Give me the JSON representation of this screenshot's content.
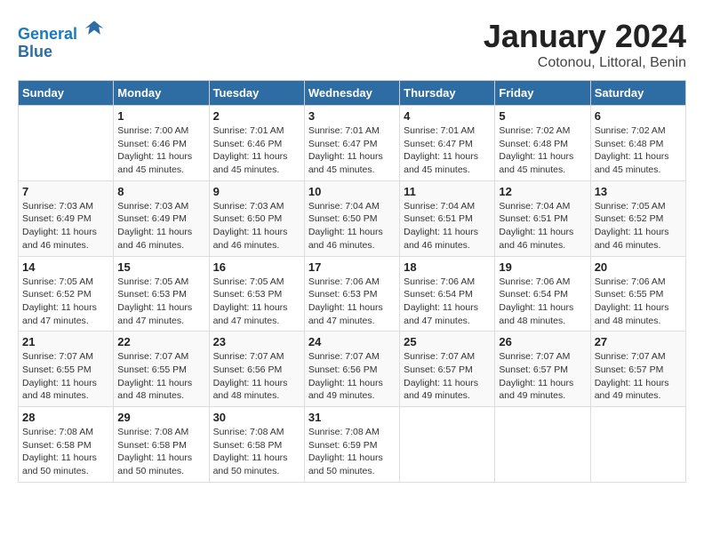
{
  "logo": {
    "line1": "General",
    "line2": "Blue"
  },
  "title": "January 2024",
  "subtitle": "Cotonou, Littoral, Benin",
  "days_of_week": [
    "Sunday",
    "Monday",
    "Tuesday",
    "Wednesday",
    "Thursday",
    "Friday",
    "Saturday"
  ],
  "weeks": [
    [
      {
        "day": "",
        "info": ""
      },
      {
        "day": "1",
        "info": "Sunrise: 7:00 AM\nSunset: 6:46 PM\nDaylight: 11 hours\nand 45 minutes."
      },
      {
        "day": "2",
        "info": "Sunrise: 7:01 AM\nSunset: 6:46 PM\nDaylight: 11 hours\nand 45 minutes."
      },
      {
        "day": "3",
        "info": "Sunrise: 7:01 AM\nSunset: 6:47 PM\nDaylight: 11 hours\nand 45 minutes."
      },
      {
        "day": "4",
        "info": "Sunrise: 7:01 AM\nSunset: 6:47 PM\nDaylight: 11 hours\nand 45 minutes."
      },
      {
        "day": "5",
        "info": "Sunrise: 7:02 AM\nSunset: 6:48 PM\nDaylight: 11 hours\nand 45 minutes."
      },
      {
        "day": "6",
        "info": "Sunrise: 7:02 AM\nSunset: 6:48 PM\nDaylight: 11 hours\nand 45 minutes."
      }
    ],
    [
      {
        "day": "7",
        "info": "Sunrise: 7:03 AM\nSunset: 6:49 PM\nDaylight: 11 hours\nand 46 minutes."
      },
      {
        "day": "8",
        "info": "Sunrise: 7:03 AM\nSunset: 6:49 PM\nDaylight: 11 hours\nand 46 minutes."
      },
      {
        "day": "9",
        "info": "Sunrise: 7:03 AM\nSunset: 6:50 PM\nDaylight: 11 hours\nand 46 minutes."
      },
      {
        "day": "10",
        "info": "Sunrise: 7:04 AM\nSunset: 6:50 PM\nDaylight: 11 hours\nand 46 minutes."
      },
      {
        "day": "11",
        "info": "Sunrise: 7:04 AM\nSunset: 6:51 PM\nDaylight: 11 hours\nand 46 minutes."
      },
      {
        "day": "12",
        "info": "Sunrise: 7:04 AM\nSunset: 6:51 PM\nDaylight: 11 hours\nand 46 minutes."
      },
      {
        "day": "13",
        "info": "Sunrise: 7:05 AM\nSunset: 6:52 PM\nDaylight: 11 hours\nand 46 minutes."
      }
    ],
    [
      {
        "day": "14",
        "info": "Sunrise: 7:05 AM\nSunset: 6:52 PM\nDaylight: 11 hours\nand 47 minutes."
      },
      {
        "day": "15",
        "info": "Sunrise: 7:05 AM\nSunset: 6:53 PM\nDaylight: 11 hours\nand 47 minutes."
      },
      {
        "day": "16",
        "info": "Sunrise: 7:05 AM\nSunset: 6:53 PM\nDaylight: 11 hours\nand 47 minutes."
      },
      {
        "day": "17",
        "info": "Sunrise: 7:06 AM\nSunset: 6:53 PM\nDaylight: 11 hours\nand 47 minutes."
      },
      {
        "day": "18",
        "info": "Sunrise: 7:06 AM\nSunset: 6:54 PM\nDaylight: 11 hours\nand 47 minutes."
      },
      {
        "day": "19",
        "info": "Sunrise: 7:06 AM\nSunset: 6:54 PM\nDaylight: 11 hours\nand 48 minutes."
      },
      {
        "day": "20",
        "info": "Sunrise: 7:06 AM\nSunset: 6:55 PM\nDaylight: 11 hours\nand 48 minutes."
      }
    ],
    [
      {
        "day": "21",
        "info": "Sunrise: 7:07 AM\nSunset: 6:55 PM\nDaylight: 11 hours\nand 48 minutes."
      },
      {
        "day": "22",
        "info": "Sunrise: 7:07 AM\nSunset: 6:55 PM\nDaylight: 11 hours\nand 48 minutes."
      },
      {
        "day": "23",
        "info": "Sunrise: 7:07 AM\nSunset: 6:56 PM\nDaylight: 11 hours\nand 48 minutes."
      },
      {
        "day": "24",
        "info": "Sunrise: 7:07 AM\nSunset: 6:56 PM\nDaylight: 11 hours\nand 49 minutes."
      },
      {
        "day": "25",
        "info": "Sunrise: 7:07 AM\nSunset: 6:57 PM\nDaylight: 11 hours\nand 49 minutes."
      },
      {
        "day": "26",
        "info": "Sunrise: 7:07 AM\nSunset: 6:57 PM\nDaylight: 11 hours\nand 49 minutes."
      },
      {
        "day": "27",
        "info": "Sunrise: 7:07 AM\nSunset: 6:57 PM\nDaylight: 11 hours\nand 49 minutes."
      }
    ],
    [
      {
        "day": "28",
        "info": "Sunrise: 7:08 AM\nSunset: 6:58 PM\nDaylight: 11 hours\nand 50 minutes."
      },
      {
        "day": "29",
        "info": "Sunrise: 7:08 AM\nSunset: 6:58 PM\nDaylight: 11 hours\nand 50 minutes."
      },
      {
        "day": "30",
        "info": "Sunrise: 7:08 AM\nSunset: 6:58 PM\nDaylight: 11 hours\nand 50 minutes."
      },
      {
        "day": "31",
        "info": "Sunrise: 7:08 AM\nSunset: 6:59 PM\nDaylight: 11 hours\nand 50 minutes."
      },
      {
        "day": "",
        "info": ""
      },
      {
        "day": "",
        "info": ""
      },
      {
        "day": "",
        "info": ""
      }
    ]
  ]
}
